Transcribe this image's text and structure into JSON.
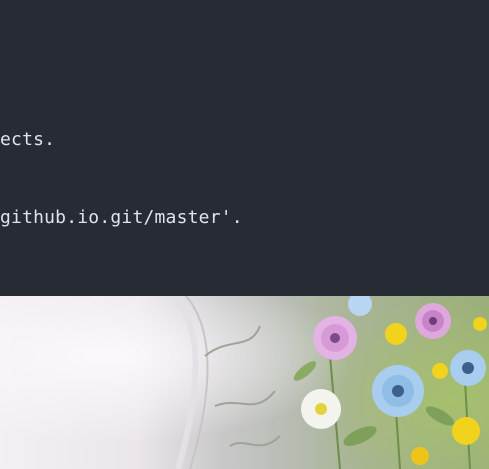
{
  "terminal": {
    "lines": [
      "ects.",
      "github.io.git/master'."
    ],
    "colors": {
      "background": "#272b33",
      "text": "#dfe3ea"
    }
  },
  "wallpaper": {
    "subject": "floral painting",
    "colors": {
      "left": "#f3eff3",
      "right": "#9aae7a",
      "flower_pink": "#d79ad8",
      "flower_blue": "#8fbde6",
      "flower_yellow": "#f1d21c"
    }
  }
}
